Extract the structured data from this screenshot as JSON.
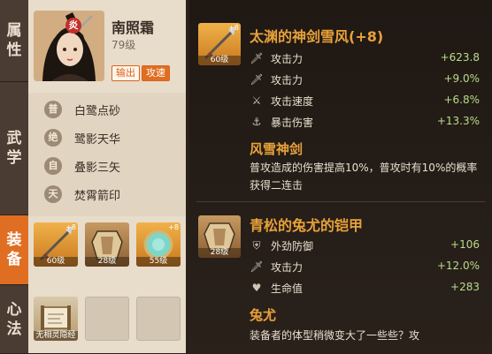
{
  "tabs": [
    {
      "line1": "属",
      "line2": "性"
    },
    {
      "line1": "武",
      "line2": "学"
    },
    {
      "line1": "装",
      "line2": "备"
    },
    {
      "line1": "心",
      "line2": "法"
    }
  ],
  "character": {
    "element_badge": "炎",
    "name": "南照霜",
    "level": "79级",
    "tags": [
      "输出",
      "攻速"
    ]
  },
  "skills": [
    {
      "icon_char": "普",
      "name": "白鹭点砂"
    },
    {
      "icon_char": "绝",
      "name": "鹭影天华"
    },
    {
      "icon_char": "自",
      "name": "叠影三矢"
    },
    {
      "icon_char": "天",
      "name": "焚霄箭印"
    }
  ],
  "equipment": [
    {
      "plus": "+8",
      "level": "60级",
      "icon": "spear-icon"
    },
    {
      "plus": "",
      "level": "28级",
      "icon": "armor-icon"
    },
    {
      "plus": "+8",
      "level": "55级",
      "icon": "amulet-icon"
    }
  ],
  "heart_method": {
    "label": "无相灵隐经",
    "icon": "scroll-icon"
  },
  "weapon_detail": {
    "plus": "+8",
    "level": "60级",
    "title": "太渊的神剑雪风(+8)",
    "stats": [
      {
        "icon": "sword-icon",
        "name": "攻击力",
        "value": "+623.8"
      },
      {
        "icon": "sword-icon",
        "name": "攻击力",
        "value": "+9.0%"
      },
      {
        "icon": "double-sword-icon",
        "name": "攻击速度",
        "value": "+6.8%"
      },
      {
        "icon": "anchor-icon",
        "name": "暴击伤害",
        "value": "+13.3%"
      }
    ],
    "passive_title": "风雪神剑",
    "passive_desc": "普攻造成的伤害提高10%，普攻时有10%的概率获得二连击"
  },
  "armor_detail": {
    "level": "28级",
    "title": "青松的兔尤的铠甲",
    "stats": [
      {
        "icon": "shield-icon",
        "name": "外劲防御",
        "value": "+106"
      },
      {
        "icon": "sword-icon",
        "name": "攻击力",
        "value": "+12.0%"
      },
      {
        "icon": "heart-icon",
        "name": "生命值",
        "value": "+283"
      }
    ],
    "passive_title": "兔尤",
    "passive_desc": "装备者的体型稍微变大了一些些？攻"
  },
  "colors": {
    "accent": "#e06e22",
    "title_gold": "#e8a13a",
    "stat_value_green": "#b8dd8a",
    "panel_bg": "#e8dccb",
    "detail_bg": "#231b16"
  }
}
